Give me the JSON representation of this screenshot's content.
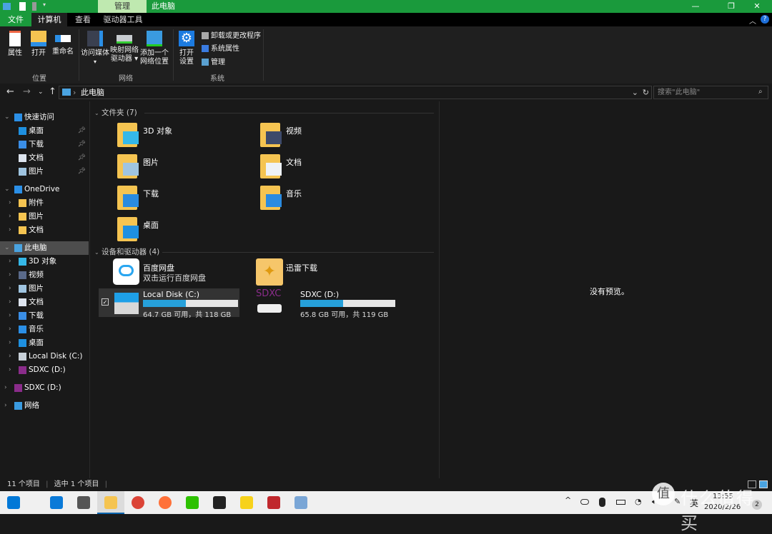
{
  "window": {
    "title": "此电脑",
    "context_tab": "管理",
    "controls": {
      "minimize": "—",
      "maximize": "❐",
      "close": "✕"
    },
    "help": "?"
  },
  "tabs": [
    {
      "label": "文件"
    },
    {
      "label": "计算机"
    },
    {
      "label": "查看"
    },
    {
      "label": "驱动器工具"
    }
  ],
  "ribbon": {
    "location": {
      "label": "位置",
      "properties": "属性",
      "open": "打开",
      "rename": "重命名"
    },
    "network": {
      "label": "网络",
      "media": "访问媒体",
      "map_drive_1": "映射网络",
      "map_drive_2": "驱动器",
      "add_loc_1": "添加一个",
      "add_loc_2": "网络位置"
    },
    "system": {
      "label": "系统",
      "settings_1": "打开",
      "settings_2": "设置",
      "uninstall": "卸载或更改程序",
      "sysprops": "系统属性",
      "manage": "管理"
    }
  },
  "address": {
    "path": "此电脑",
    "search_placeholder": "搜索\"此电脑\""
  },
  "sidebar": [
    {
      "label": "快速访问",
      "level": 0,
      "expanded": true,
      "icon": "star",
      "color": "#2b8fe6"
    },
    {
      "label": "桌面",
      "level": 1,
      "pinned": true,
      "icon": "desktop",
      "color": "#1e90e0"
    },
    {
      "label": "下载",
      "level": 1,
      "pinned": true,
      "icon": "download",
      "color": "#3a8ee6"
    },
    {
      "label": "文档",
      "level": 1,
      "pinned": true,
      "icon": "document",
      "color": "#dde4ee"
    },
    {
      "label": "图片",
      "level": 1,
      "pinned": true,
      "icon": "pictures",
      "color": "#9fc4e0"
    },
    {
      "label": "OneDrive",
      "level": 0,
      "expanded": true,
      "icon": "cloud",
      "color": "#2b8fe6",
      "gap": true
    },
    {
      "label": "附件",
      "level": 2,
      "icon": "folder",
      "color": "#f5c451"
    },
    {
      "label": "图片",
      "level": 2,
      "icon": "folder",
      "color": "#f5c451"
    },
    {
      "label": "文档",
      "level": 2,
      "icon": "folder",
      "color": "#f5c451"
    },
    {
      "label": "此电脑",
      "level": 0,
      "expanded": true,
      "selected": true,
      "icon": "computer",
      "color": "#4aa3e0",
      "gap": true
    },
    {
      "label": "3D 对象",
      "level": 2,
      "icon": "3d",
      "color": "#35b8e8"
    },
    {
      "label": "视频",
      "level": 2,
      "icon": "video",
      "color": "#5a6a8a"
    },
    {
      "label": "图片",
      "level": 2,
      "icon": "pictures",
      "color": "#9fc4e0"
    },
    {
      "label": "文档",
      "level": 2,
      "icon": "document",
      "color": "#dde4ee"
    },
    {
      "label": "下载",
      "level": 2,
      "icon": "download",
      "color": "#3a8ee6"
    },
    {
      "label": "音乐",
      "level": 2,
      "icon": "music",
      "color": "#2b8fe6"
    },
    {
      "label": "桌面",
      "level": 2,
      "icon": "desktop",
      "color": "#1e90e0"
    },
    {
      "label": "Local Disk (C:)",
      "level": 2,
      "icon": "drive",
      "color": "#c8d0d8"
    },
    {
      "label": "SDXC (D:)",
      "level": 2,
      "icon": "sd",
      "color": "#8a2c8a"
    },
    {
      "label": "SDXC (D:)",
      "level": 0,
      "collapsed": true,
      "icon": "sd",
      "color": "#8a2c8a",
      "gap": true
    },
    {
      "label": "网络",
      "level": 0,
      "collapsed": true,
      "icon": "network",
      "color": "#3a9be0",
      "gap": true
    }
  ],
  "main": {
    "folders_header": "文件夹 (7)",
    "folders": [
      {
        "label": "3D 对象",
        "overlay": "#35b8e8"
      },
      {
        "label": "视频",
        "overlay": "#3d4a6a"
      },
      {
        "label": "图片",
        "overlay": "#9fc4e0"
      },
      {
        "label": "文档",
        "overlay": "#eef2f6"
      },
      {
        "label": "下载",
        "overlay": "#2a8be0"
      },
      {
        "label": "音乐",
        "overlay": "#2a8be0"
      },
      {
        "label": "桌面",
        "overlay": "#1e90e0"
      }
    ],
    "devices_header": "设备和驱动器 (4)",
    "apps": [
      {
        "label": "百度网盘",
        "sub": "双击运行百度网盘"
      },
      {
        "label": "迅雷下载"
      }
    ],
    "drives": [
      {
        "label": "Local Disk (C:)",
        "free": "64.7 GB 可用，共 118 GB",
        "used_percent": 45,
        "selected": true,
        "checked": true
      },
      {
        "label": "SDXC (D:)",
        "free": "65.8 GB 可用，共 119 GB",
        "used_percent": 45,
        "logo": "SDXC"
      }
    ]
  },
  "preview": {
    "text": "没有预览。"
  },
  "status": {
    "items": "11 个项目",
    "selected": "选中 1 个项目"
  },
  "taskbar": {
    "apps": [
      {
        "name": "start",
        "color": "#0078d7"
      },
      {
        "name": "edge",
        "color": "#0a7ad8"
      },
      {
        "name": "mail",
        "color": "#555555"
      },
      {
        "name": "file-explorer",
        "color": "#f5c451",
        "active": true
      },
      {
        "name": "chrome",
        "color": "#db4437"
      },
      {
        "name": "firefox",
        "color": "#ff7139"
      },
      {
        "name": "wechat",
        "color": "#2dc100"
      },
      {
        "name": "qq",
        "color": "#222222"
      },
      {
        "name": "app-yellow",
        "color": "#f7d21b"
      },
      {
        "name": "app-red",
        "color": "#c0282d"
      },
      {
        "name": "paint",
        "color": "#7aa6d6"
      }
    ],
    "ime": "英",
    "time": "13:55",
    "date": "2020/2/26",
    "notifications": "2"
  },
  "watermark": "什么值得买"
}
